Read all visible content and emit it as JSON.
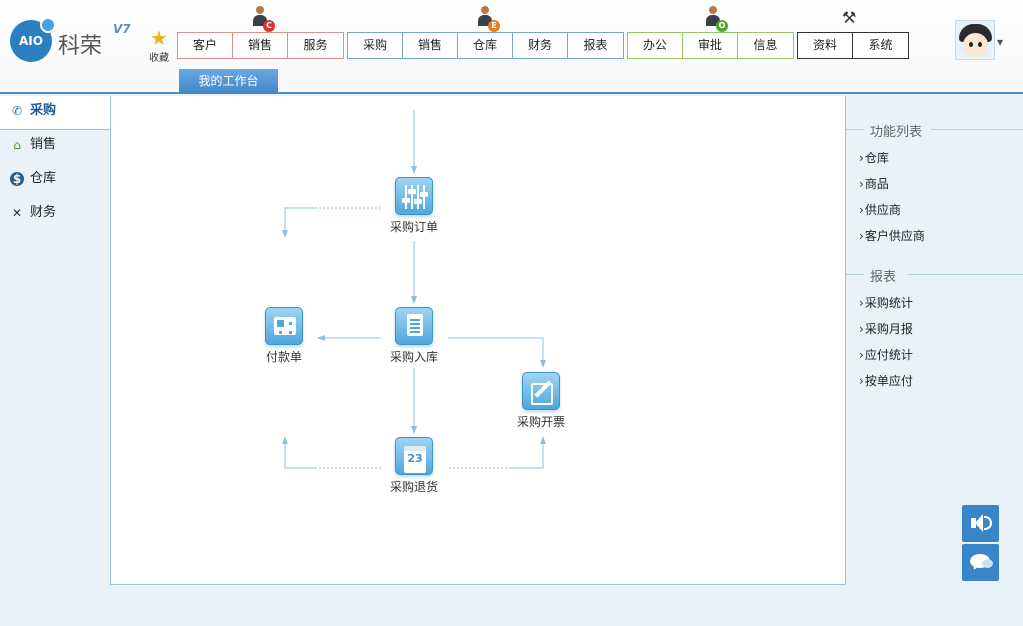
{
  "brand": {
    "logo_text": "AIO",
    "name": "科荣",
    "version": "V7"
  },
  "favorite": {
    "label": "收藏"
  },
  "groups": [
    {
      "badge": "C",
      "badge_color": "#d9342b",
      "items": [
        "客户",
        "销售",
        "服务"
      ]
    },
    {
      "badge": "E",
      "badge_color": "#ee7a1b",
      "items": [
        "采购",
        "销售",
        "仓库",
        "财务",
        "报表"
      ]
    },
    {
      "badge": "O",
      "badge_color": "#58a52c",
      "items": [
        "办公",
        "审批",
        "信息"
      ]
    },
    {
      "badge": "",
      "items": [
        "资料",
        "系统"
      ]
    }
  ],
  "work_tab": "我的工作台",
  "sidebar": {
    "items": [
      {
        "label": "采购",
        "icon": "phone-icon",
        "active": true
      },
      {
        "label": "销售",
        "icon": "home-icon"
      },
      {
        "label": "仓库",
        "icon": "dollar-coin-icon"
      },
      {
        "label": "财务",
        "icon": "tools-icon"
      }
    ]
  },
  "flow": {
    "nodes": {
      "order": "采购订单",
      "inbound": "采购入库",
      "payment": "付款单",
      "invoice": "采购开票",
      "return": "采购退货",
      "calendar_day": "23"
    }
  },
  "right_panel": {
    "sections": [
      {
        "title": "功能列表",
        "links": [
          "仓库",
          "商品",
          "供应商",
          "客户供应商"
        ]
      },
      {
        "title": "报表",
        "links": [
          "采购统计",
          "采购月报",
          "应付统计",
          "按单应付"
        ]
      }
    ]
  },
  "colors": {
    "accent": "#3a85c8",
    "flow_line": "#8cc0dc",
    "group_red": "#e08e8e",
    "group_blue": "#7ba3cc",
    "group_green": "#98c466"
  }
}
